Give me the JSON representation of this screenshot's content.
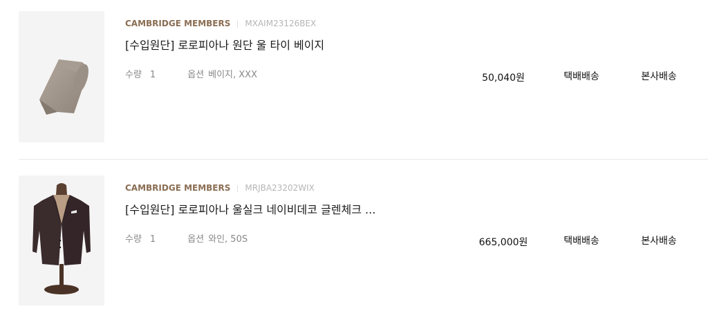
{
  "items": [
    {
      "brand": "CAMBRIDGE MEMBERS",
      "code": "MXAIM23126BEX",
      "title": "[수입원단] 로로피아나 원단 울 타이 베이지",
      "qty_label": "수량",
      "qty": "1",
      "option_label": "옵션",
      "option": "베이지, XXX",
      "price": "50,040원",
      "delivery_type": "택배배송",
      "delivery_source": "본사배송",
      "image": "beige-tie-image"
    },
    {
      "brand": "CAMBRIDGE MEMBERS",
      "code": "MRJBA23202WIX",
      "title": "[수입원단] 로로피아나 울실크 네이비데코 글렌체크 ...",
      "qty_label": "수량",
      "qty": "1",
      "option_label": "옵션",
      "option": "와인, 50S",
      "price": "665,000원",
      "delivery_type": "택배배송",
      "delivery_source": "본사배송",
      "image": "jacket-on-mannequin-image"
    }
  ]
}
